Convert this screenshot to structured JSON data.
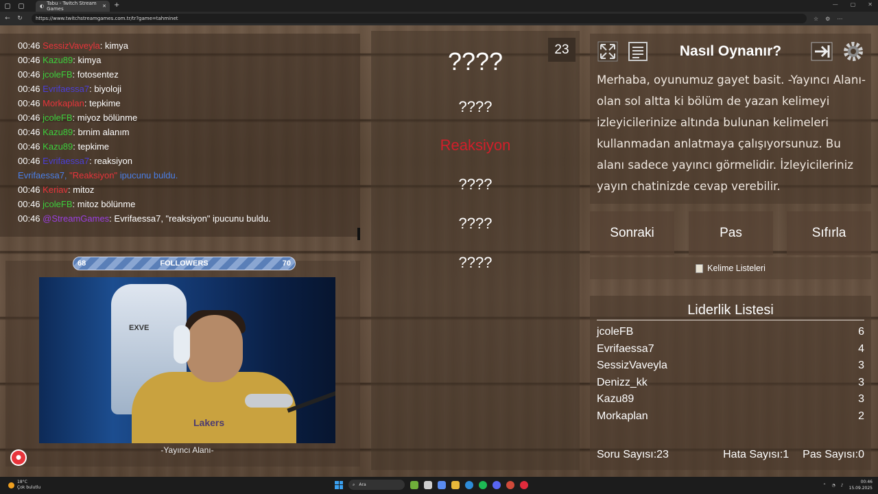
{
  "browser": {
    "tab_title": "Tabu - Twitch Stream Games",
    "url": "https://www.twitchstreamgames.com.tr/tr?game=tahminet"
  },
  "chat": [
    {
      "time": "00:46",
      "user": "SessizVaveyla",
      "color": "#e8343b",
      "msg": "kimya"
    },
    {
      "time": "00:46",
      "user": "Kazu89",
      "color": "#3ccf3c",
      "msg": "kimya"
    },
    {
      "time": "00:46",
      "user": "jcoleFB",
      "color": "#3ccf3c",
      "msg": "fotosentez"
    },
    {
      "time": "00:46",
      "user": "Evrifaessa7",
      "color": "#4a3fd8",
      "msg": "biyoloji"
    },
    {
      "time": "00:46",
      "user": "Morkaplan",
      "color": "#e8343b",
      "msg": "tepkime"
    },
    {
      "time": "00:46",
      "user": "jcoleFB",
      "color": "#3ccf3c",
      "msg": "miyoz bölünme"
    },
    {
      "time": "00:46",
      "user": "Kazu89",
      "color": "#3ccf3c",
      "msg": "brnim alanım"
    },
    {
      "time": "00:46",
      "user": "Kazu89",
      "color": "#3ccf3c",
      "msg": "tepkime"
    },
    {
      "time": "00:46",
      "user": "Evrifaessa7",
      "color": "#4a3fd8",
      "msg": "reaksiyon"
    },
    {
      "system": true,
      "user": "Evrifaessa7,",
      "word": "\"Reaksiyon\"",
      "msg": "ipucunu buldu."
    },
    {
      "time": "00:46",
      "user": "Keriav",
      "color": "#e8343b",
      "msg": "mitoz"
    },
    {
      "time": "00:46",
      "user": "jcoleFB",
      "color": "#3ccf3c",
      "msg": "mitoz bölünme"
    },
    {
      "time": "00:46",
      "user": "@StreamGames",
      "color": "#9a3fe0",
      "msg": "Evrifaessa7, \"reaksiyon\" ipucunu buldu."
    }
  ],
  "followers": {
    "current": "68",
    "label": "FOLLOWERS",
    "goal": "70"
  },
  "webcam": {
    "chair_brand": "EXVE",
    "shirt_text": "Lakers",
    "label": "-Yayıncı Alanı-"
  },
  "card": {
    "timer": "23",
    "words": [
      "????",
      "????",
      "Reaksiyon",
      "????",
      "????",
      "????"
    ]
  },
  "howto": {
    "title": "Nasıl Oynanır?",
    "text": "Merhaba, oyunumuz gayet basit. -Yayıncı Alanı- olan sol altta ki bölüm de yazan kelimeyi izleyicilerinize altında bulunan kelimeleri kullanmadan anlatmaya çalışıyorsunuz. Bu alanı sadece yayıncı görmelidir. İzleyicileriniz yayın chatinizde cevap verebilir."
  },
  "buttons": {
    "next": "Sonraki",
    "pass": "Pas",
    "reset": "Sıfırla"
  },
  "word_lists": "Kelime Listeleri",
  "leaderboard": {
    "title": "Liderlik Listesi",
    "rows": [
      {
        "name": "jcoleFB",
        "score": "6"
      },
      {
        "name": "Evrifaessa7",
        "score": "4"
      },
      {
        "name": "SessizVaveyla",
        "score": "3"
      },
      {
        "name": "Denizz_kk",
        "score": "3"
      },
      {
        "name": "Kazu89",
        "score": "3"
      },
      {
        "name": "Morkaplan",
        "score": "2"
      }
    ]
  },
  "stats": {
    "questions": "Soru Sayısı:23",
    "errors": "Hata Sayısı:1",
    "passes": "Pas Sayısı:0"
  },
  "taskbar": {
    "temp": "18°C",
    "weather": "Çok bulutlu",
    "search": "Ara",
    "time": "00:46",
    "date": "15.09.2025"
  }
}
